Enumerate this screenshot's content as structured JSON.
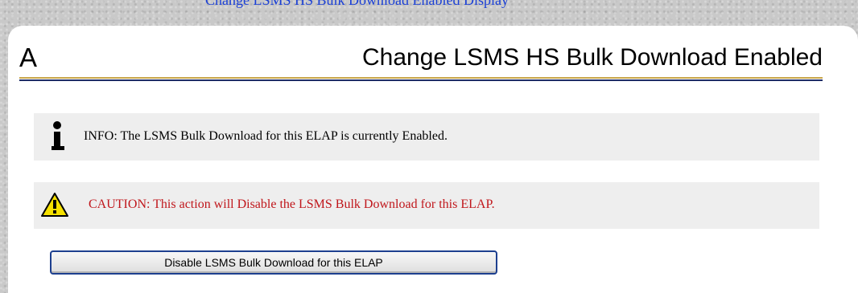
{
  "top_nav": {
    "link_text": "Change LSMS HS Bulk Download Enabled  Display"
  },
  "header": {
    "letter": "A",
    "title": "Change LSMS HS Bulk Download Enabled"
  },
  "info": {
    "icon": "info-icon",
    "text": "INFO: The LSMS Bulk Download for this ELAP is currently Enabled."
  },
  "caution": {
    "icon": "warning-triangle-icon",
    "text": "CAUTION: This action will Disable the LSMS Bulk Download for this ELAP.",
    "color": "#c0161b"
  },
  "action": {
    "button_label": "Disable LSMS Bulk Download for this ELAP"
  },
  "colors": {
    "link": "#1a3fd6",
    "rule_gold": "#c9a64a",
    "rule_navy": "#1f2d66",
    "button_border": "#1d3f8f",
    "warning_yellow": "#f5e000"
  }
}
